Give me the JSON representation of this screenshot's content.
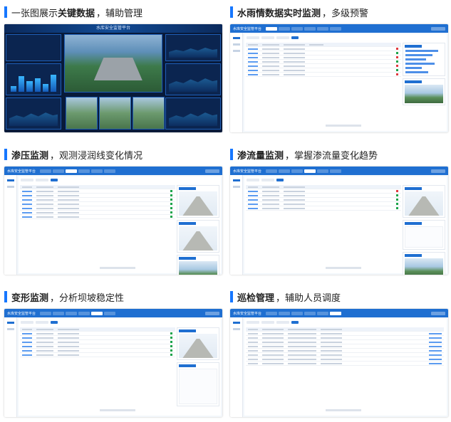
{
  "panels": [
    {
      "bold_pre": "",
      "plain_pre": "一张图展示",
      "bold": "关键数据",
      "plain": "，辅助管理"
    },
    {
      "bold_pre": "水雨情数据实时监测",
      "plain_pre": "",
      "bold": "",
      "plain": "，多级预警"
    },
    {
      "bold_pre": "渗压监测",
      "plain_pre": "",
      "bold": "",
      "plain": "，观测浸润线变化情况"
    },
    {
      "bold_pre": "渗流量监测",
      "plain_pre": "",
      "bold": "",
      "plain": "，掌握渗流量变化趋势"
    },
    {
      "bold_pre": "变形监测",
      "plain_pre": "",
      "bold": "",
      "plain": "，分析坝坡稳定性"
    },
    {
      "bold_pre": "巡检管理",
      "plain_pre": "",
      "bold": "",
      "plain": "，辅助人员调度"
    }
  ],
  "app": {
    "dashboard_title": "水库安全监管平台",
    "platform_name": "水库安全监管平台"
  },
  "accent": "#1677ff"
}
